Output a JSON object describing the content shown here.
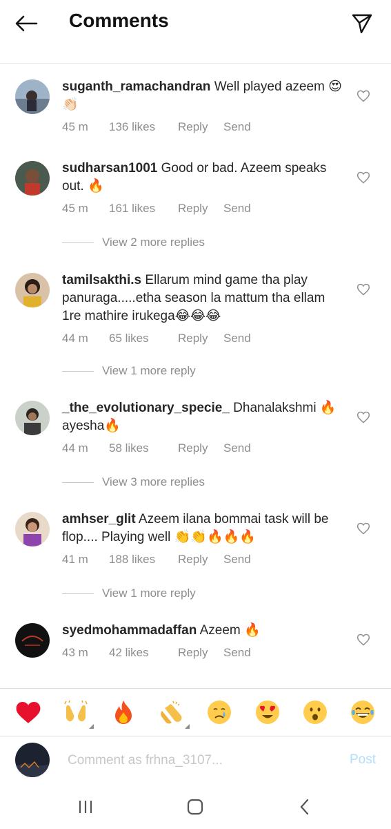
{
  "header": {
    "title": "Comments"
  },
  "comments": [
    {
      "username": "suganth_ramachandran",
      "text": "Well played azeem 😍👏🏻",
      "time": "45 m",
      "likes": "136 likes",
      "reply": "Reply",
      "send": "Send"
    },
    {
      "username": "sudharsan1001",
      "text": "Good or bad. Azeem speaks out. 🔥",
      "time": "45 m",
      "likes": "161 likes",
      "reply": "Reply",
      "send": "Send",
      "view_replies": "View 2 more replies"
    },
    {
      "username": "tamilsakthi.s",
      "text": "Ellarum mind game tha play panuraga.....etha season la mattum tha ellam 1re mathire irukega😂😂😂",
      "time": "44 m",
      "likes": "65 likes",
      "reply": "Reply",
      "send": "Send",
      "view_replies": "View 1 more reply"
    },
    {
      "username": "_the_evolutionary_specie_",
      "text": "Dhanalakshmi 🔥ayesha🔥",
      "time": "44 m",
      "likes": "58 likes",
      "reply": "Reply",
      "send": "Send",
      "view_replies": "View 3 more replies"
    },
    {
      "username": "amhser_glit",
      "text": "Azeem ilana bommai task will be flop.... Playing well 👏👏🔥🔥🔥",
      "time": "41 m",
      "likes": "188 likes",
      "reply": "Reply",
      "send": "Send",
      "view_replies": "View 1 more reply"
    },
    {
      "username": "syedmohammadaffan",
      "text": "Azeem 🔥",
      "time": "43 m",
      "likes": "42 likes",
      "reply": "Reply",
      "send": "Send"
    }
  ],
  "emoji_bar": [
    "❤️",
    "🙌",
    "🔥",
    "👏",
    "😢",
    "😍",
    "😮",
    "😂"
  ],
  "input": {
    "placeholder": "Comment as frhna_3107...",
    "post_label": "Post"
  },
  "colors": {
    "accent_post_disabled": "#b2dffc",
    "meta_gray": "#8e8e8e",
    "text": "#262626"
  }
}
